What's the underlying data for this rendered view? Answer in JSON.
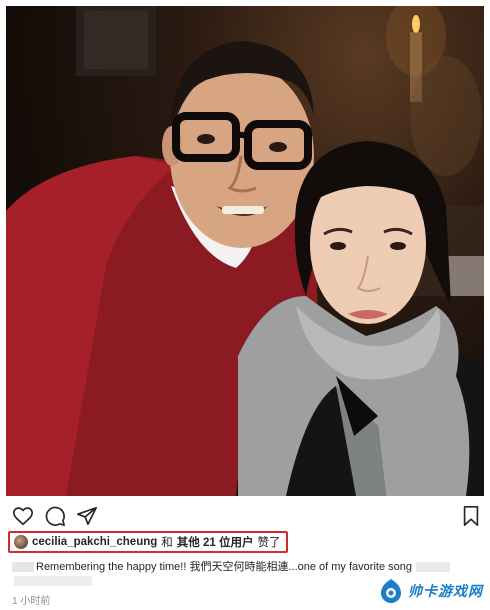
{
  "post": {
    "actions": {
      "like_icon": "heart-outline-icon",
      "comment_icon": "comment-bubble-icon",
      "share_icon": "paper-plane-icon",
      "save_icon": "bookmark-icon"
    },
    "likes": {
      "user": "cecilia_pakchi_cheung",
      "and_text": "和",
      "others": "其他 21 位用户",
      "liked_text": "赞了"
    },
    "caption": "Remembering the happy time!! 我們天空何時能相連...one of my favorite song",
    "timestamp": "1 小时前"
  },
  "watermark": {
    "text": "帅卡游戏网"
  },
  "colors": {
    "highlight_border": "#d22b2b",
    "watermark_blue": "#1a7fc9",
    "meta_gray": "#8e8e8e"
  }
}
